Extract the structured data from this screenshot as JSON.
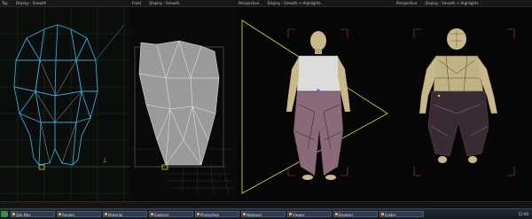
{
  "viewports": [
    {
      "header": [
        "Top",
        "Display : Smooth"
      ]
    },
    {
      "header": [
        "Front",
        "Display : Smooth"
      ]
    },
    {
      "header": [
        "Perspective",
        "Display : Smooth + Highlights"
      ]
    },
    {
      "header": [
        "Perspective",
        "Display : Smooth + Highlights"
      ]
    }
  ],
  "taskbar": {
    "items": [
      "3ds Max",
      "Render",
      "Material",
      "Explorer",
      "Photoshop",
      "Notepad",
      "Viewer",
      "Browser",
      "Folder"
    ],
    "clock": "12:00"
  },
  "colors": {
    "wire_blue": "#3aa6d8",
    "wire_white": "#cfcfcf",
    "body_tan": "#c9b98a",
    "pants_dark": "#3a2a33",
    "pants_mauve": "#8a6a7a",
    "gizmo_yellow": "#c8c84a",
    "grid": "#1f2a1f"
  }
}
